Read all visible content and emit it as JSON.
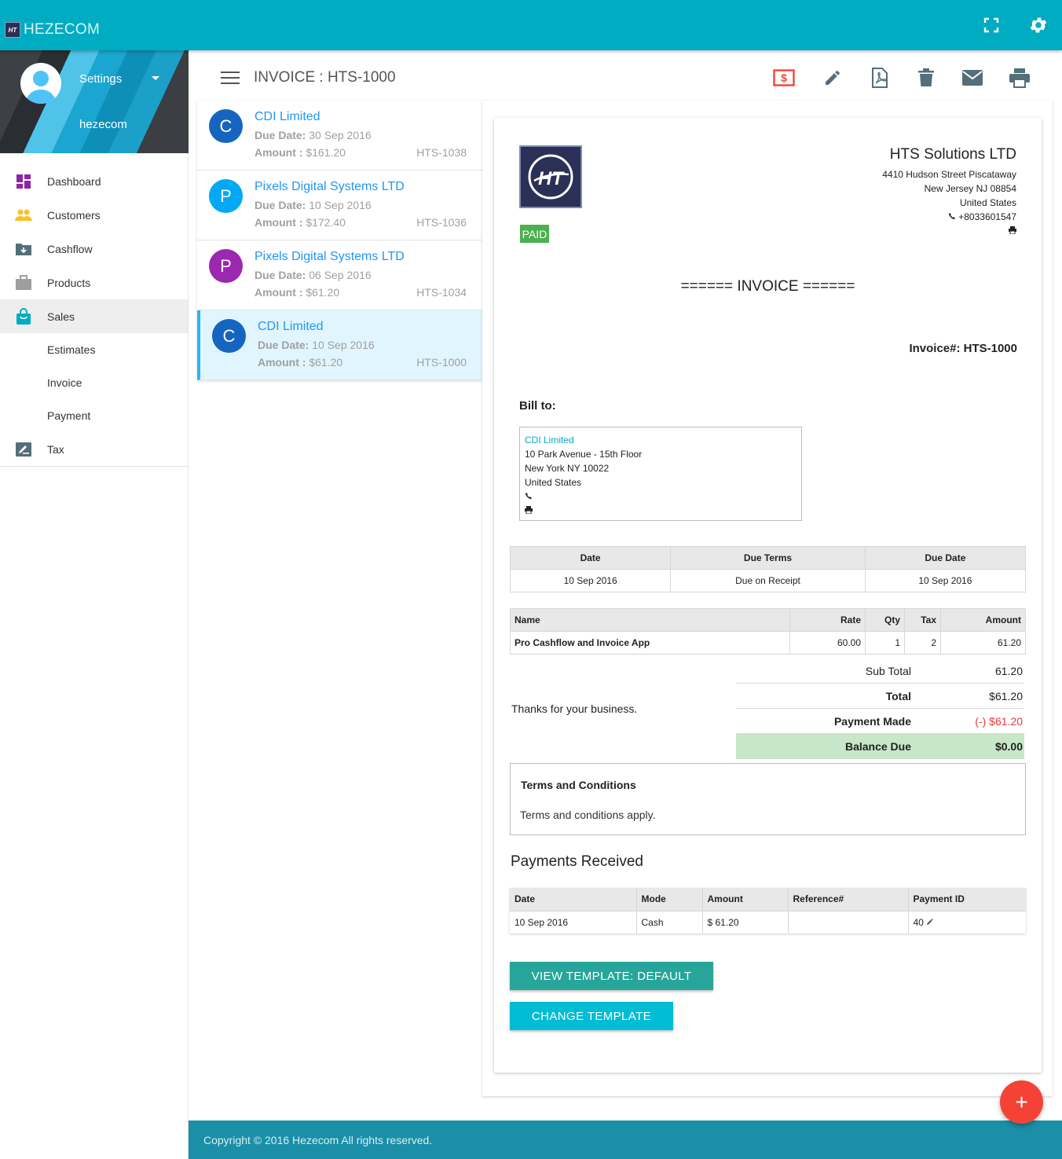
{
  "app": {
    "brand": "HEZECOM",
    "logo_text": "HT"
  },
  "colors": {
    "topbar": "#00acc1",
    "accent": "#2196f3",
    "paid": "#4caf50",
    "fab": "#f44336",
    "footer": "#1b8fa8"
  },
  "profile": {
    "settings_label": "Settings",
    "username": "hezecom"
  },
  "sidebar": {
    "items": [
      {
        "label": "Dashboard",
        "icon": "dashboard-icon"
      },
      {
        "label": "Customers",
        "icon": "people-icon"
      },
      {
        "label": "Cashflow",
        "icon": "folder-download-icon"
      },
      {
        "label": "Products",
        "icon": "briefcase-icon"
      },
      {
        "label": "Sales",
        "icon": "shopping-bag-icon"
      },
      {
        "label": "Estimates"
      },
      {
        "label": "Invoice"
      },
      {
        "label": "Payment"
      },
      {
        "label": "Tax",
        "icon": "edit-note-icon"
      }
    ]
  },
  "header": {
    "title": "INVOICE : HTS-1000"
  },
  "invoice_list": [
    {
      "initial": "C",
      "color": "#1565c0",
      "name": "CDI Limited",
      "due_label": "Due Date:",
      "due": "30 Sep 2016",
      "amount_label": "Amount :",
      "amount": "$161.20",
      "code": "HTS-1038"
    },
    {
      "initial": "P",
      "color": "#03a9f4",
      "name": "Pixels Digital Systems LTD",
      "due_label": "Due Date:",
      "due": "10 Sep 2016",
      "amount_label": "Amount :",
      "amount": "$172.40",
      "code": "HTS-1036"
    },
    {
      "initial": "P",
      "color": "#9c27b0",
      "name": "Pixels Digital Systems LTD",
      "due_label": "Due Date:",
      "due": "06 Sep 2016",
      "amount_label": "Amount :",
      "amount": "$61.20",
      "code": "HTS-1034"
    },
    {
      "initial": "C",
      "color": "#1565c0",
      "name": "CDI Limited",
      "due_label": "Due Date:",
      "due": "10 Sep 2016",
      "amount_label": "Amount :",
      "amount": "$61.20",
      "code": "HTS-1000"
    }
  ],
  "document": {
    "status": "PAID",
    "company": {
      "name": "HTS Solutions LTD",
      "street": "4410 Hudson Street Piscataway",
      "city": "New Jersey NJ 08854",
      "country": "United States",
      "phone": "+8033601547"
    },
    "heading": "====== INVOICE ======",
    "invoice_number": "Invoice#: HTS-1000",
    "bill_to_label": "Bill to:",
    "bill_to": {
      "name": "CDI Limited",
      "street": "10 Park Avenue - 15th Floor",
      "city": "New York NY 10022",
      "country": "United States"
    },
    "dates": {
      "headers": [
        "Date",
        "Due Terms",
        "Due Date"
      ],
      "values": [
        "10 Sep 2016",
        "Due on Receipt",
        "10 Sep 2016"
      ]
    },
    "items": {
      "headers": [
        "Name",
        "Rate",
        "Qty",
        "Tax",
        "Amount"
      ],
      "rows": [
        [
          "Pro Cashflow and Invoice App",
          "60.00",
          "1",
          "2",
          "61.20"
        ]
      ]
    },
    "thanks": "Thanks for your business.",
    "totals": {
      "sub_total_label": "Sub Total",
      "sub_total": "61.20",
      "total_label": "Total",
      "total": "$61.20",
      "payment_made_label": "Payment Made",
      "payment_made": "(-) $61.20",
      "balance_due_label": "Balance Due",
      "balance_due": "$0.00"
    },
    "terms": {
      "title": "Terms and Conditions",
      "body": "Terms and conditions apply."
    },
    "payments": {
      "title": "Payments Received",
      "headers": [
        "Date",
        "Mode",
        "Amount",
        "Reference#",
        "Payment ID"
      ],
      "rows": [
        [
          "10 Sep 2016",
          "Cash",
          "$ 61.20",
          "",
          "40"
        ]
      ]
    },
    "buttons": {
      "view_template": "VIEW TEMPLATE: DEFAULT",
      "change_template": "CHANGE TEMPLATE"
    }
  },
  "fab_label": "+",
  "footer": {
    "text": "Copyright © 2016 Hezecom All rights reserved."
  }
}
